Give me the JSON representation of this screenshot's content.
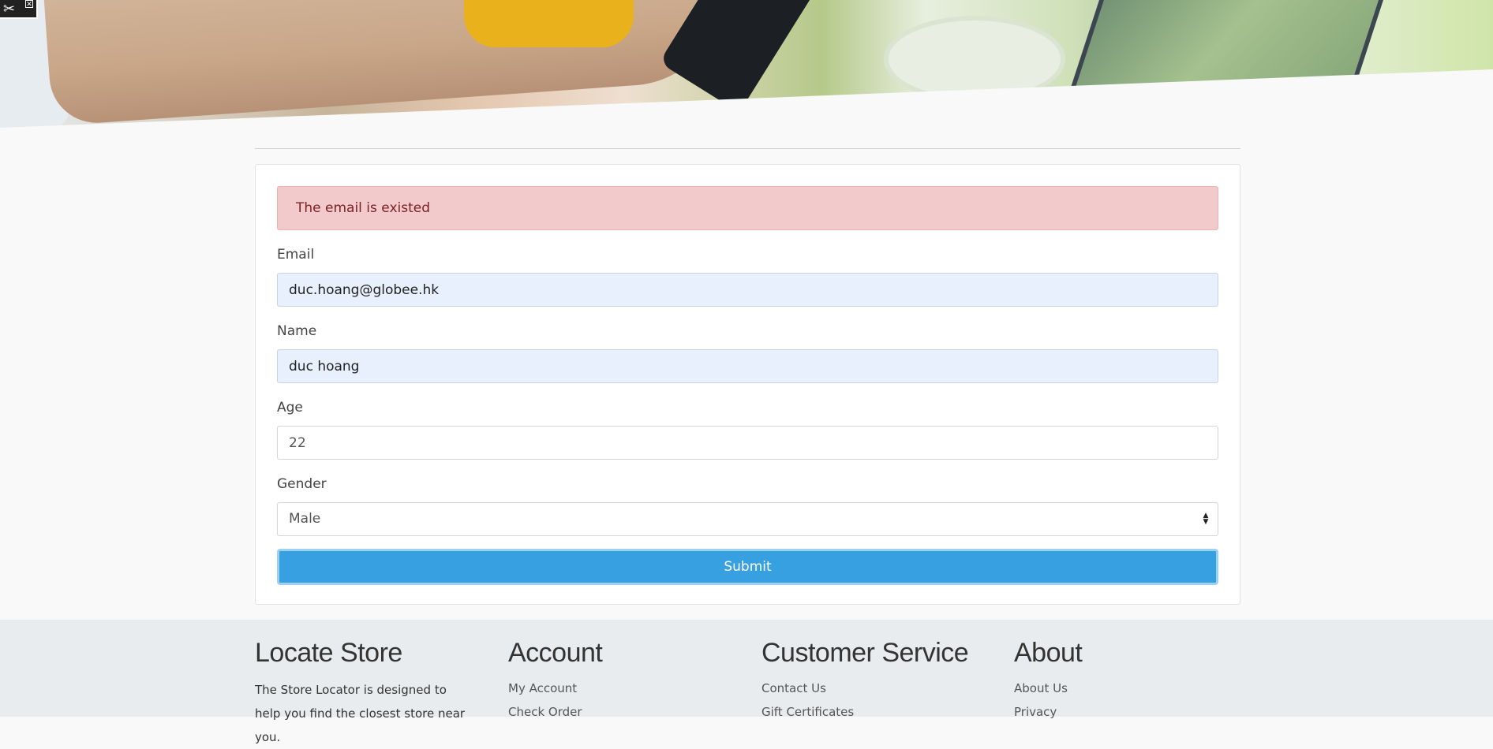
{
  "alert": {
    "message": "The email is existed"
  },
  "form": {
    "email": {
      "label": "Email",
      "value": "duc.hoang@globee.hk"
    },
    "name": {
      "label": "Name",
      "value": "duc hoang"
    },
    "age": {
      "label": "Age",
      "value": "22"
    },
    "gender": {
      "label": "Gender",
      "value": "Male"
    },
    "submit_label": "Submit"
  },
  "footer": {
    "locate": {
      "title": "Locate Store",
      "text": "The Store Locator is designed to help you find the closest store near you."
    },
    "account": {
      "title": "Account",
      "links": [
        "My Account",
        "Check Order"
      ]
    },
    "service": {
      "title": "Customer Service",
      "links": [
        "Contact Us",
        "Gift Certificates"
      ]
    },
    "about": {
      "title": "About",
      "links": [
        "About Us",
        "Privacy"
      ]
    }
  },
  "colors": {
    "alert_bg": "#f2cacb",
    "submit_bg": "#37a0e0",
    "autofill_bg": "#e8f0fe",
    "footer_bg": "#e9ecef"
  },
  "icons": {
    "toolbar": "tools-icon",
    "toolbar_close": "close-icon"
  }
}
